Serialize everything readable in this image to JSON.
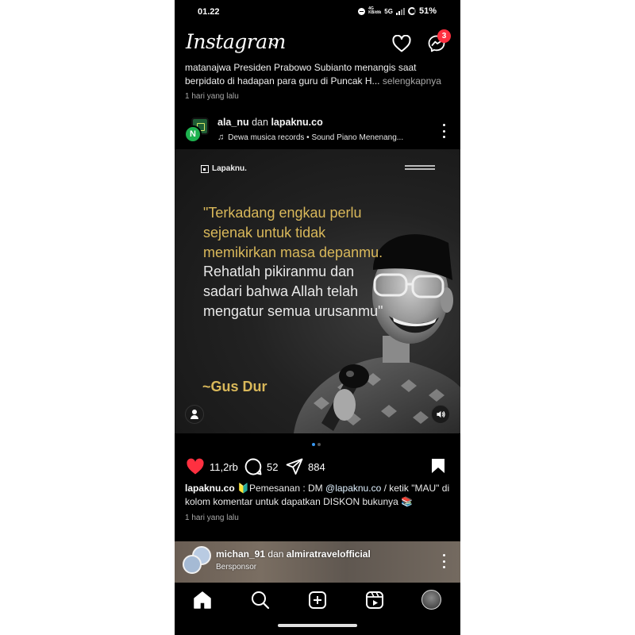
{
  "status_bar": {
    "time": "01.22",
    "net_top": "4G",
    "net_bottom": "KB/dtk",
    "net_type": "5G",
    "battery": "51%"
  },
  "top_bar": {
    "logo": "Instagram",
    "message_badge": "3",
    "icons": [
      "chevron-down-icon",
      "heart-icon",
      "messenger-icon"
    ]
  },
  "prev_post": {
    "caption": "matanajwa Presiden Prabowo Subianto menangis saat berpidato di hadapan para guru di Puncak H...",
    "more": "selengkapnya",
    "time": "1 hari yang lalu"
  },
  "post": {
    "user1": "ala_nu",
    "joiner": "dan",
    "user2": "lapaknu.co",
    "music": "Dewa musica records • Sound Piano Menenang...",
    "avatar_letter": "N",
    "image": {
      "brand": "Lapaknu.",
      "quote_gold": "\"Terkadang engkau perlu sejenak untuk tidak memikirkan masa depanmu.",
      "quote_rest": " Rehatlah pikiranmu dan sadari bahwa Allah telah mengatur semua urusanmu\"",
      "author": "~Gus Dur"
    },
    "likes": "11,2rb",
    "comments": "52",
    "shares": "884",
    "caption_user": "lapaknu.co",
    "caption_part1": " 🔰Pemesanan : DM ",
    "caption_mention": "@lapaknu.co",
    "caption_part2": " / ketik \"MAU\" di kolom komentar untuk dapatkan DISKON bukunya 📚",
    "time": "1 hari yang lalu"
  },
  "sponsored": {
    "user1": "michan_91",
    "joiner": "dan",
    "user2": "almiratravelofficial",
    "label": "Bersponsor"
  },
  "colors": {
    "accent_red": "#ff3040",
    "quote_gold": "#d9b85a",
    "dot_active": "#3897f0"
  }
}
